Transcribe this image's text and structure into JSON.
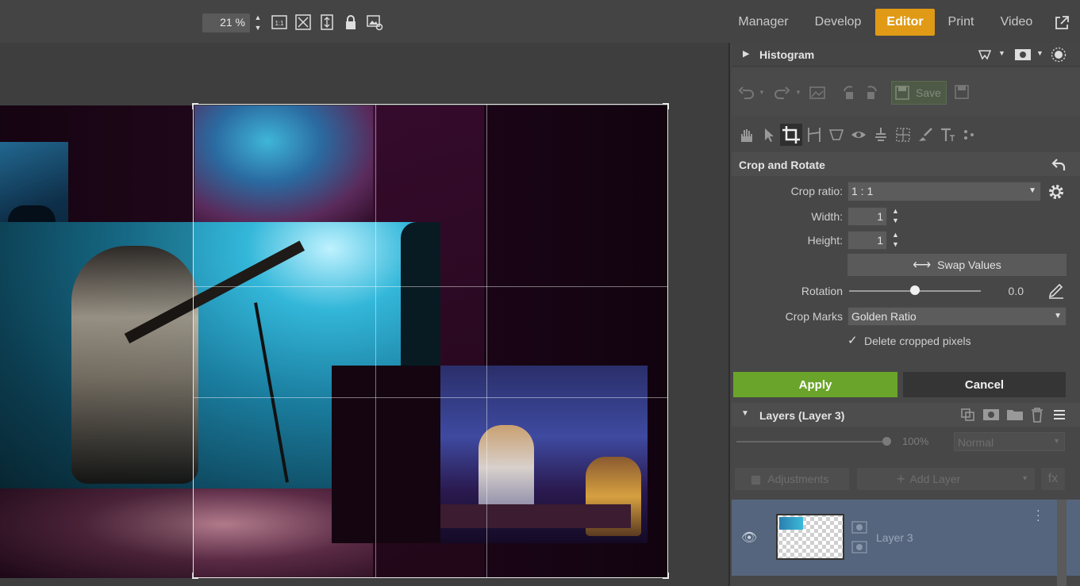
{
  "toolbar": {
    "zoom_value": "21 %",
    "icons": [
      "zoom-stepper-icon",
      "actual-size-icon",
      "fit-screen-icon",
      "fit-height-icon",
      "lock-icon",
      "image-settings-icon"
    ]
  },
  "nav": {
    "items": [
      {
        "label": "Manager",
        "active": false
      },
      {
        "label": "Develop",
        "active": false
      },
      {
        "label": "Editor",
        "active": true
      },
      {
        "label": "Print",
        "active": false
      },
      {
        "label": "Video",
        "active": false
      }
    ],
    "external_icon": "external-window-icon"
  },
  "histogram": {
    "title": "Histogram"
  },
  "edit_toolbar": {
    "save_label": "Save"
  },
  "crop": {
    "title": "Crop and Rotate",
    "ratio_label": "Crop ratio:",
    "ratio_value": "1 : 1",
    "width_label": "Width:",
    "width_value": "1",
    "height_label": "Height:",
    "height_value": "1",
    "swap_label": "Swap Values",
    "rotation_label": "Rotation",
    "rotation_value": "0.0",
    "rotation_fraction": 0.5,
    "marks_label": "Crop Marks",
    "marks_value": "Golden Ratio",
    "delete_label": "Delete cropped pixels",
    "delete_checked": true,
    "apply_label": "Apply",
    "cancel_label": "Cancel"
  },
  "layers": {
    "title": "Layers (Layer 3)",
    "opacity_value": "100%",
    "opacity_fraction": 1.0,
    "blend_mode": "Normal",
    "adjustments_label": "Adjustments",
    "add_layer_label": "Add Layer",
    "fx_label": "fx",
    "items": [
      {
        "name": "Layer 3",
        "visible": true
      }
    ]
  },
  "colors": {
    "accent": "#e09a16",
    "apply": "#6aa42a",
    "layer_selected": "#55657d"
  }
}
